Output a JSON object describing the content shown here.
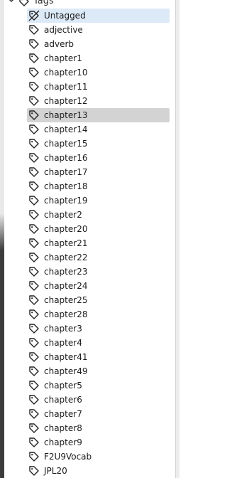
{
  "header": {
    "label": "Tags",
    "expand_icon": "chevron-down-icon",
    "icon": "tag-icon"
  },
  "tags": {
    "items": [
      {
        "label": "Untagged",
        "icon": "untagged-icon",
        "state": "hover"
      },
      {
        "label": "adjective",
        "icon": "tag-icon"
      },
      {
        "label": "adverb",
        "icon": "tag-icon"
      },
      {
        "label": "chapter1",
        "icon": "tag-icon"
      },
      {
        "label": "chapter10",
        "icon": "tag-icon"
      },
      {
        "label": "chapter11",
        "icon": "tag-icon"
      },
      {
        "label": "chapter12",
        "icon": "tag-icon"
      },
      {
        "label": "chapter13",
        "icon": "tag-icon",
        "state": "selected"
      },
      {
        "label": "chapter14",
        "icon": "tag-icon"
      },
      {
        "label": "chapter15",
        "icon": "tag-icon"
      },
      {
        "label": "chapter16",
        "icon": "tag-icon"
      },
      {
        "label": "chapter17",
        "icon": "tag-icon"
      },
      {
        "label": "chapter18",
        "icon": "tag-icon"
      },
      {
        "label": "chapter19",
        "icon": "tag-icon"
      },
      {
        "label": "chapter2",
        "icon": "tag-icon"
      },
      {
        "label": "chapter20",
        "icon": "tag-icon"
      },
      {
        "label": "chapter21",
        "icon": "tag-icon"
      },
      {
        "label": "chapter22",
        "icon": "tag-icon"
      },
      {
        "label": "chapter23",
        "icon": "tag-icon"
      },
      {
        "label": "chapter24",
        "icon": "tag-icon"
      },
      {
        "label": "chapter25",
        "icon": "tag-icon"
      },
      {
        "label": "chapter28",
        "icon": "tag-icon"
      },
      {
        "label": "chapter3",
        "icon": "tag-icon"
      },
      {
        "label": "chapter4",
        "icon": "tag-icon"
      },
      {
        "label": "chapter41",
        "icon": "tag-icon"
      },
      {
        "label": "chapter49",
        "icon": "tag-icon"
      },
      {
        "label": "chapter5",
        "icon": "tag-icon"
      },
      {
        "label": "chapter6",
        "icon": "tag-icon"
      },
      {
        "label": "chapter7",
        "icon": "tag-icon"
      },
      {
        "label": "chapter8",
        "icon": "tag-icon"
      },
      {
        "label": "chapter9",
        "icon": "tag-icon"
      },
      {
        "label": "F2U9Vocab",
        "icon": "tag-icon"
      },
      {
        "label": "JPL20",
        "icon": "tag-icon"
      }
    ]
  },
  "colors": {
    "hover_bg": "#dce9f7",
    "selected_bg": "#d3d3d3",
    "text": "#1a1a1a"
  }
}
